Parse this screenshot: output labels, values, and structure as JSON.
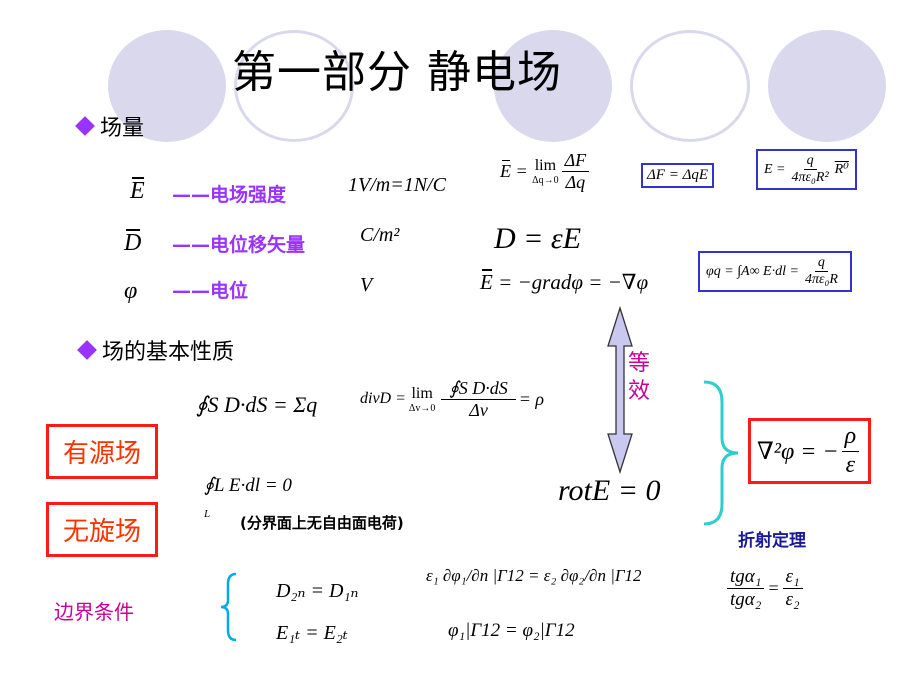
{
  "slide": {
    "title": "第一部分  静电场",
    "section_field_quantities": "场量",
    "section_field_properties": "场的基本性质",
    "colors": {
      "accent_purple": "#9933ff",
      "red": "#ff3300",
      "blue_box": "#3333cc",
      "magenta": "#cc0099",
      "navy": "#1a1a99",
      "cyan_brace": "#33cccc",
      "circle_fill": "#d9d8ec"
    }
  },
  "quantities": [
    {
      "symbol": "E",
      "dash": "——",
      "name": "电场强度",
      "unit": "1V/m=1N/C",
      "formula": "E = lim(Δq→0) ΔF/Δq"
    },
    {
      "symbol": "D",
      "dash": "——",
      "name": "电位移矢量",
      "unit": "C/m²",
      "formula": "D = εE"
    },
    {
      "symbol": "φ",
      "dash": "——",
      "name": "电位",
      "unit": "V",
      "formula": "E = −gradφ = −∇φ"
    }
  ],
  "formula_parts": {
    "lim": "lim",
    "lim_sub_q": "Δq→0",
    "lim_sub_v": "Δv→0",
    "dF": "ΔF",
    "dq": "Δq",
    "D_eq": "D = εE",
    "grad": "= −gradφ = −∇φ",
    "box1": "ΔF = ΔqE",
    "box2_lhs": "E =",
    "box2_num": "q",
    "box2_den": "4πε₀R²",
    "box2_tail": "R⁰",
    "box3_lhs": "φq = ∫A∞ E·dl =",
    "box3_num": "q",
    "box3_den": "4πε₀R"
  },
  "properties": {
    "gauss": "∮S D·dS = Σq",
    "div_lhs": "divD =",
    "div_num": "∮S D·dS",
    "div_den": "Δv",
    "div_rhs": "= ρ",
    "curl_integral": "∮L E·dl = 0",
    "curl_sub": "L",
    "rot": "rotE = 0",
    "equivalent": [
      "等",
      "效"
    ],
    "poisson_lhs": "∇²φ = −",
    "poisson_num": "ρ",
    "poisson_den": "ε",
    "source_field": "有源场",
    "irrotational_field": "无旋场",
    "note": "(分界面上无自由面电荷)"
  },
  "boundary": {
    "label": "边界条件",
    "eq1": "D₂ₙ = D₁ₙ",
    "eq2": "E₁ₜ = E₂ₜ",
    "eq3": "ε₁ ∂φ₁/∂n |Γ12 = ε₂ ∂φ₂/∂n |Γ12",
    "eq4": "φ₁|Γ12 = φ₂|Γ12",
    "refraction_label": "折射定理",
    "refraction_num_l": "tgα₁",
    "refraction_den_l": "tgα₂",
    "refraction_num_r": "ε₁",
    "refraction_den_r": "ε₂"
  }
}
